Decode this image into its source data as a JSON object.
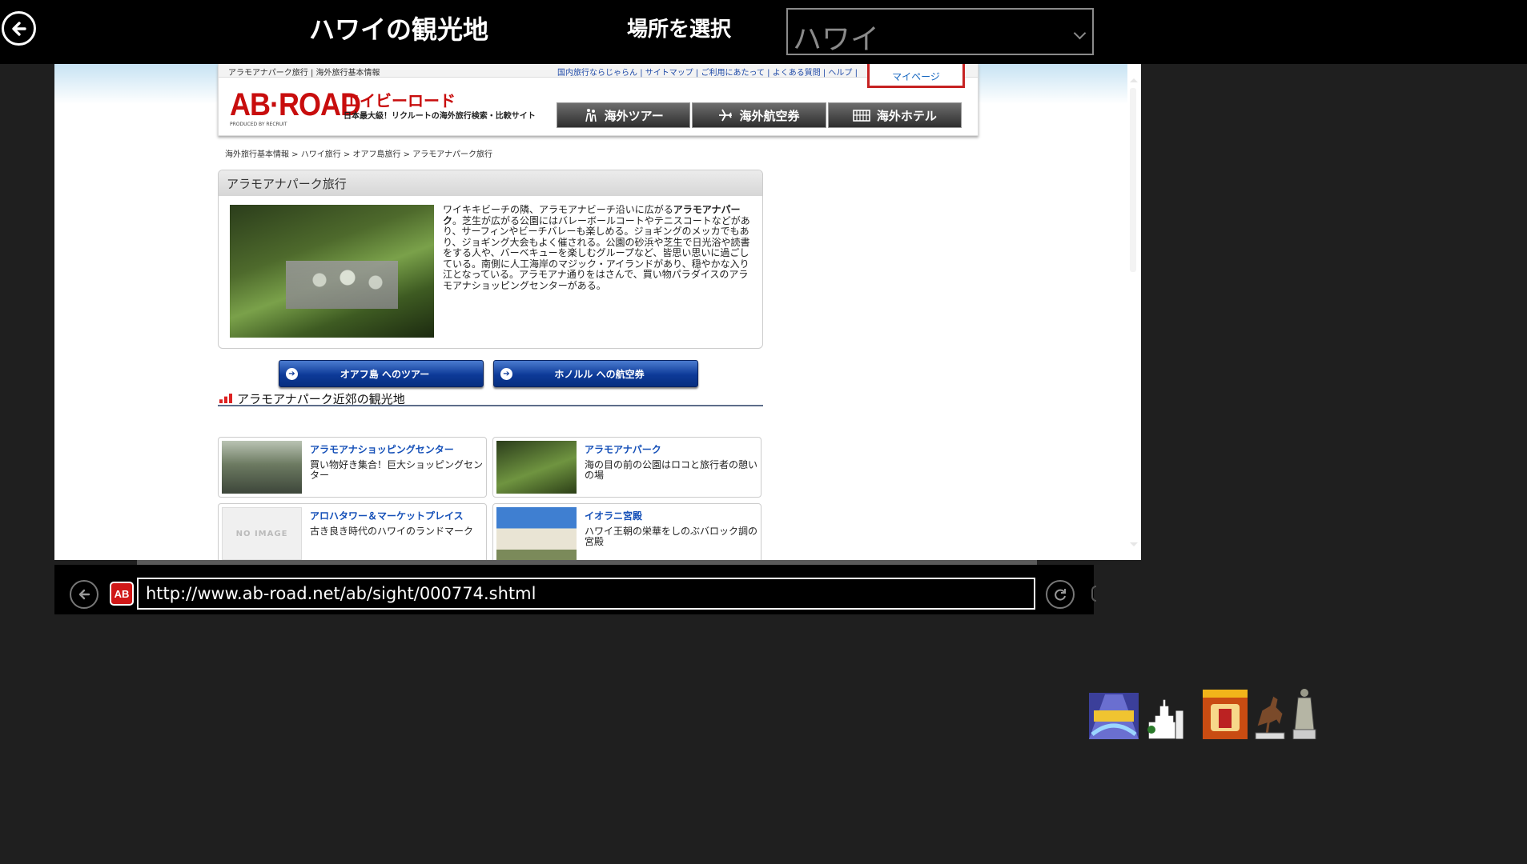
{
  "app": {
    "title": "ハワイの観光地",
    "location_label": "場所を選択",
    "location_value": "ハワイ"
  },
  "site": {
    "topline": "アラモアナパーク旅行 | 海外旅行基本情報",
    "toplinks": "国内旅行ならじゃらん | サイトマップ | ご利用にあたって | よくある質問 | ヘルプ |",
    "mypage": "マイページ",
    "logo": "AB·ROAD",
    "logo_kana": "エイビーロード",
    "tagline": "日本最大級！リクルートの海外旅行検索・比較サイト",
    "produced": "PRODUCED BY RECRUIT",
    "nav": [
      "海外ツアー",
      "海外航空券",
      "海外ホテル"
    ]
  },
  "breadcrumb": "海外旅行基本情報 > ハワイ旅行 > オアフ島旅行 > アラモアナパーク旅行",
  "main": {
    "heading": "アラモアナパーク旅行",
    "desc_pre": "ワイキキビーチの隣、アラモアナビーチ沿いに広がる",
    "desc_bold": "アラモアナパーク",
    "desc_post": "。芝生が広がる公園にはバレーボールコートやテニスコートなどがあり、サーフィンやビーチバレーも楽しめる。ジョギングのメッカでもあり、ジョギング大会もよく催される。公園の砂浜や芝生で日光浴や読書をする人や、バーベキューを楽しむグループなど、皆思い思いに過ごしている。南側に人工海岸のマジック・アイランドがあり、穏やかな入り江となっている。アラモアナ通りをはさんで、買い物パラダイスのアラモアナショッピングセンターがある。"
  },
  "buttons": {
    "tour": "オアフ島 へのツアー",
    "air": "ホノルル への航空券"
  },
  "nearby": {
    "heading": "アラモアナパーク近郊の観光地",
    "no_image": "NO IMAGE",
    "items": [
      {
        "title": "アラモアナショッピングセンター",
        "desc": "買い物好き集合！巨大ショッピングセンター"
      },
      {
        "title": "アラモアナパーク",
        "desc": "海の目の前の公園はロコと旅行者の憩いの場"
      },
      {
        "title": "アロハタワー＆マーケットプレイス",
        "desc": "古き良き時代のハワイのランドマーク"
      },
      {
        "title": "イオラニ宮殿",
        "desc": "ハワイ王朝の栄華をしのぶバロック調の宮殿"
      }
    ]
  },
  "browser": {
    "favicon": "AB",
    "url": "http://www.ab-road.net/ab/sight/000774.shtml"
  },
  "icons": [
    "back-arrow-icon",
    "chevron-down-icon",
    "refresh-icon",
    "tour-people-icon",
    "airplane-icon",
    "hotel-building-icon",
    "arrow-right-circle-icon"
  ],
  "colors": {
    "brand_red": "#c80d0d",
    "link_blue": "#1550b8",
    "button_blue": "#0d3a98",
    "app_bg": "#1f1f1f"
  }
}
